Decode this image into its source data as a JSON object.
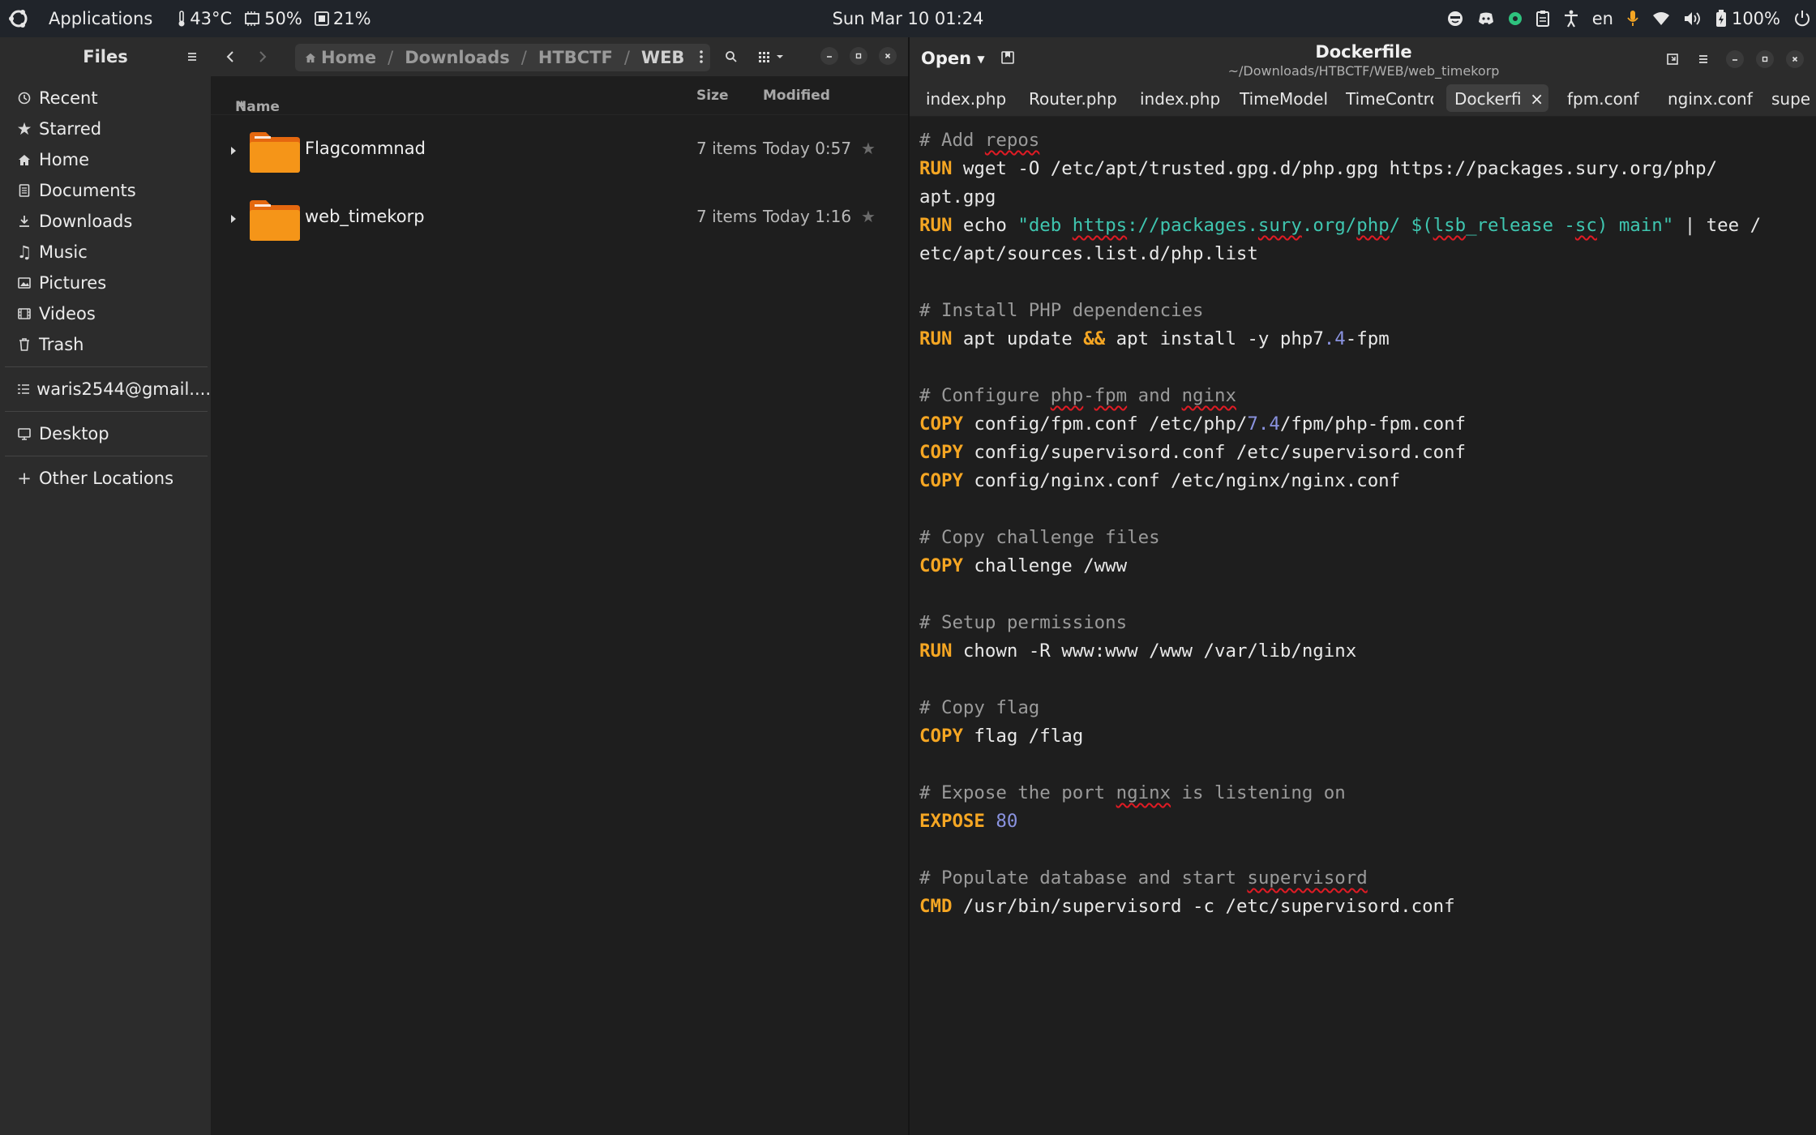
{
  "topbar": {
    "applications": "Applications",
    "temperature": "43°C",
    "cpu": "50%",
    "memory": "21%",
    "clock": "Sun Mar 10  01:24",
    "language": "en",
    "battery": "100%"
  },
  "files": {
    "title": "Files",
    "sidebar": {
      "places": [
        "Recent",
        "Starred",
        "Home",
        "Documents",
        "Downloads",
        "Music",
        "Pictures",
        "Videos",
        "Trash"
      ],
      "account": "waris2544@gmail....",
      "desktop": "Desktop",
      "other": "Other Locations"
    },
    "breadcrumb": [
      "Home",
      "Downloads",
      "HTBCTF",
      "WEB"
    ],
    "columns": {
      "name": "Name",
      "size": "Size",
      "modified": "Modified"
    },
    "rows": [
      {
        "name": "Flagcommnad",
        "size": "7 items",
        "modified": "Today 0:57"
      },
      {
        "name": "web_timekorp",
        "size": "7 items",
        "modified": "Today 1:16"
      }
    ]
  },
  "editor": {
    "open_label": "Open",
    "title": "Dockerfile",
    "path": "~/Downloads/HTBCTF/WEB/web_timekorp",
    "tabs": [
      "index.php",
      "Router.php",
      "index.php",
      "TimeModel",
      "TimeContro",
      "Dockerfi",
      "fpm.conf",
      "nginx.conf",
      "supe"
    ],
    "tab_close": "×",
    "code": {
      "c1": "# Add ",
      "c1w": "repos",
      "l2kw": "RUN",
      "l2": " wget -O /etc/apt/trusted.gpg.d/php.gpg https://packages.sury.org/php/",
      "l3": "apt.gpg",
      "l4kw": "RUN",
      "l4a": " echo ",
      "l4s1": "\"deb ",
      "l4u1": "https",
      "l4s2": "://packages.",
      "l4u2": "sury",
      "l4s3": ".org/",
      "l4u3": "php",
      "l4s4": "/ $(",
      "l4u4": "lsb",
      "l4s5": "_release -",
      "l4u5": "sc",
      "l4s6": ") main\"",
      "l4b": " | tee /",
      "l5": "etc/apt/sources.list.d/php.list",
      "c2": "# Install PHP dependencies",
      "l7kw": "RUN",
      "l7a": " apt update ",
      "l7op": "&&",
      "l7b": " apt install -y php7",
      "l7num": ".4",
      "l7c": "-fpm",
      "c3a": "# Configure ",
      "c3w1": "php",
      "c3b": "-",
      "c3w2": "fpm",
      "c3c": " and ",
      "c3w3": "nginx",
      "l9kw": "COPY",
      "l9a": " config/fpm.conf /etc/php/",
      "l9num": "7.4",
      "l9b": "/fpm/php-fpm.conf",
      "l10kw": "COPY",
      "l10": " config/supervisord.conf /etc/supervisord.conf",
      "l11kw": "COPY",
      "l11": " config/nginx.conf /etc/nginx/nginx.conf",
      "c4": "# Copy challenge files",
      "l13kw": "COPY",
      "l13": " challenge /www",
      "c5": "# Setup permissions",
      "l15kw": "RUN",
      "l15": " chown -R www:www /www /var/lib/nginx",
      "c6": "# Copy flag",
      "l17kw": "COPY",
      "l17": " flag /flag",
      "c7a": "# Expose the port ",
      "c7w": "nginx",
      "c7b": " is listening on",
      "l19kw": "EXPOSE",
      "l19num": "80",
      "c8a": "# Populate database and start ",
      "c8w": "supervisord",
      "l21kw": "CMD",
      "l21": " /usr/bin/supervisord -c /etc/supervisord.conf"
    }
  }
}
